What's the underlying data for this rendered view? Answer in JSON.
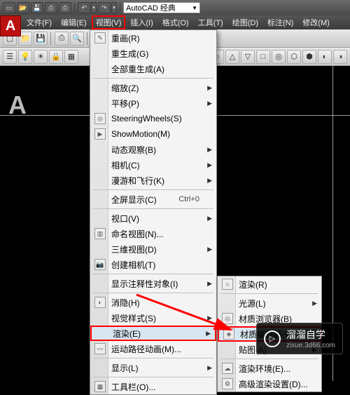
{
  "workspace": {
    "name": "AutoCAD 经典"
  },
  "menubar": {
    "file": "文件(F)",
    "edit": "编辑(E)",
    "view": "视图(V)",
    "insert": "插入(I)",
    "format": "格式(O)",
    "tools": "工具(T)",
    "draw": "绘图(D)",
    "annotate": "标注(N)",
    "modify": "修改(M)"
  },
  "view_menu": {
    "redraw": "重画(R)",
    "regen": "重生成(G)",
    "regen_all": "全部重生成(A)",
    "zoom": "缩放(Z)",
    "pan": "平移(P)",
    "steering": "SteeringWheels(S)",
    "showmotion": "ShowMotion(M)",
    "orbit": "动态观察(B)",
    "camera": "相机(C)",
    "walkfly": "漫游和飞行(K)",
    "fullscreen": "全屏显示(C)",
    "fullscreen_accel": "Ctrl+0",
    "viewport": "视口(V)",
    "named": "命名视图(N)...",
    "view3d": "三维视图(D)",
    "create_cam": "创建相机(T)",
    "show_anno": "显示注释性对象(I)",
    "hide": "消隐(H)",
    "visual": "视觉样式(S)",
    "render": "渲染(E)",
    "motion_path": "运动路径动画(M)...",
    "display": "显示(L)",
    "toolbar": "工具栏(O)..."
  },
  "render_submenu": {
    "render": "渲染(R)",
    "light": "光源(L)",
    "mat_browser": "材质浏览器(B)",
    "mat_editor": "材质编辑器(M)",
    "map": "贴图(A)",
    "env": "渲染环境(E)...",
    "advanced": "高级渲染设置(D)..."
  },
  "watermark": {
    "text": "溜溜自学",
    "url": "zixue.3d66.com"
  },
  "logo": "A"
}
